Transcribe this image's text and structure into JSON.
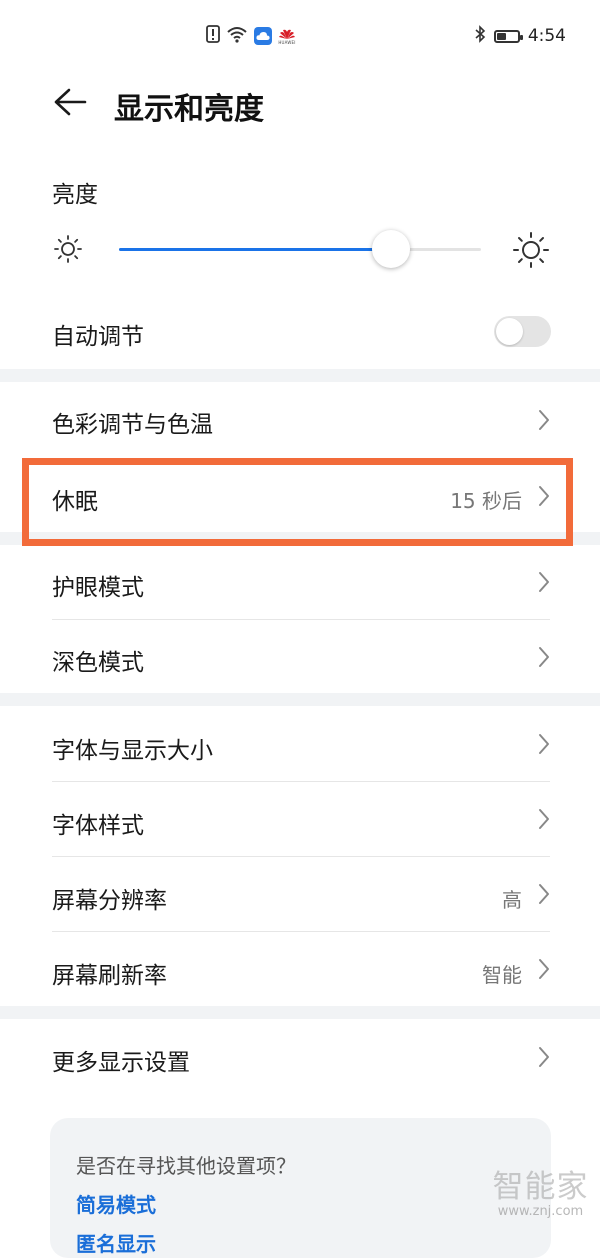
{
  "status_bar": {
    "time": "4:54",
    "battery_level": 0.5,
    "brand_text": "HUAWEI",
    "icons": [
      "alert-icon",
      "wifi-icon",
      "cloud-icon",
      "huawei-logo-icon",
      "bluetooth-icon",
      "battery-icon"
    ]
  },
  "header": {
    "title": "显示和亮度",
    "back_icon": "back-arrow-icon"
  },
  "brightness": {
    "label": "亮度",
    "level": 0.75,
    "accent_color": "#1a73e8"
  },
  "auto_adjust": {
    "label": "自动调节",
    "enabled": false
  },
  "groups": [
    {
      "items": [
        {
          "label": "色彩调节与色温",
          "value": ""
        },
        {
          "label": "休眠",
          "value": "15 秒后"
        }
      ]
    },
    {
      "items": [
        {
          "label": "护眼模式",
          "value": ""
        },
        {
          "label": "深色模式",
          "value": ""
        }
      ]
    },
    {
      "items": [
        {
          "label": "字体与显示大小",
          "value": ""
        },
        {
          "label": "字体样式",
          "value": ""
        },
        {
          "label": "屏幕分辨率",
          "value": "高"
        },
        {
          "label": "屏幕刷新率",
          "value": "智能"
        }
      ]
    },
    {
      "items": [
        {
          "label": "更多显示设置",
          "value": ""
        }
      ]
    }
  ],
  "hint": {
    "question": "是否在寻找其他设置项？",
    "link1": "简易模式",
    "link2": "匿名显示"
  },
  "highlight_color": "#f26b3a",
  "watermark": {
    "brand": "智能家",
    "url": "www.znj.com"
  }
}
